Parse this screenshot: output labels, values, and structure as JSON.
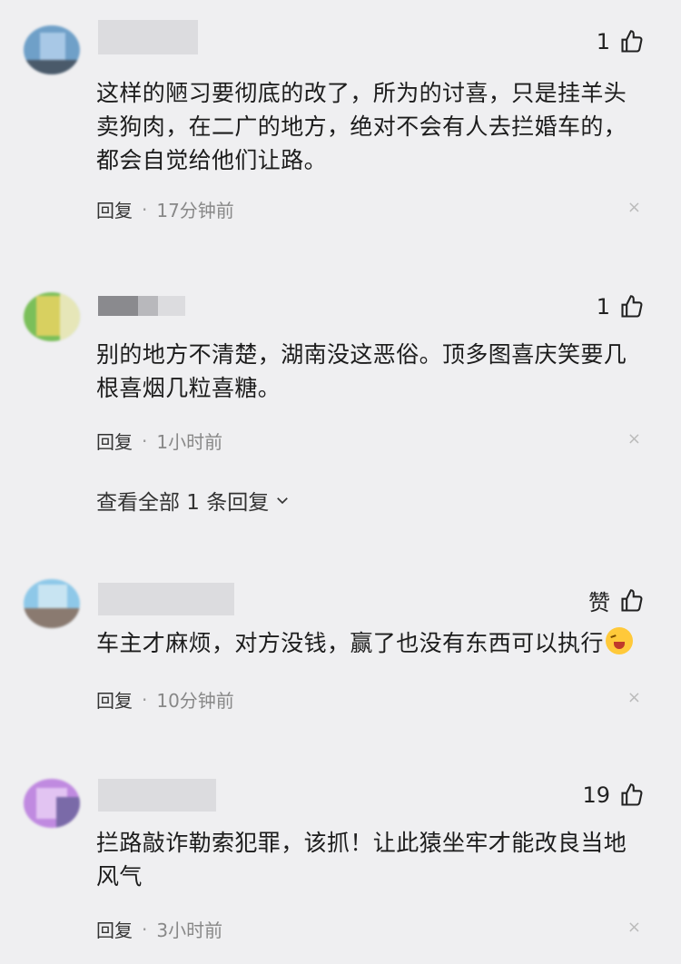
{
  "comments": [
    {
      "likes": "1",
      "lines": [
        "这样的陋习要彻底的改了，所为的讨喜，只是挂羊头",
        "卖狗肉，在二广的地方，绝对不会有人去拦婚车的，",
        "都会自觉给他们让路。"
      ],
      "reply": "回复",
      "time": "17分钟前",
      "close": "×"
    },
    {
      "likes": "1",
      "lines": [
        "别的地方不清楚，湖南没这恶俗。顶多图喜庆笑要几",
        "根喜烟几粒喜糖。"
      ],
      "reply": "回复",
      "time": "1小时前",
      "close": "×"
    },
    {
      "likes": "赞",
      "lines": [
        "车主才麻烦，对方没钱，赢了也没有东西可以执行"
      ],
      "emoji": "laughing-crying-emoji",
      "reply": "回复",
      "time": "10分钟前",
      "close": "×"
    },
    {
      "likes": "19",
      "lines": [
        "拦路敲诈勒索犯罪，该抓！让此猿坐牢才能改良当地",
        "风气"
      ],
      "reply": "回复",
      "time": "3小时前",
      "close": "×"
    }
  ],
  "view_all": "查看全部 1 条回复",
  "dot": "·",
  "icons": {
    "like": "thumbs-up-icon",
    "expand": "chevron-down-icon"
  }
}
